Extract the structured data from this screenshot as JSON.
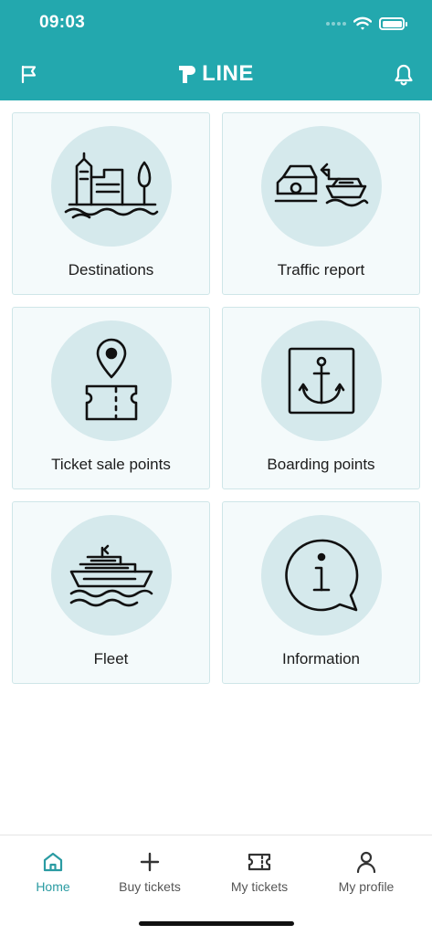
{
  "status_bar": {
    "time": "09:03"
  },
  "header": {
    "logo_mark": "P",
    "logo_text": "LINE",
    "left_icon": "flag-icon",
    "right_icon": "bell-icon"
  },
  "tiles": [
    {
      "label": "Destinations",
      "icon": "destinations-icon"
    },
    {
      "label": "Traffic report",
      "icon": "traffic-report-icon"
    },
    {
      "label": "Ticket sale points",
      "icon": "ticket-sale-points-icon"
    },
    {
      "label": "Boarding points",
      "icon": "anchor-icon"
    },
    {
      "label": "Fleet",
      "icon": "ship-icon"
    },
    {
      "label": "Information",
      "icon": "info-icon"
    }
  ],
  "tabbar": {
    "active": "Home",
    "items": [
      {
        "label": "Home",
        "icon": "home-icon"
      },
      {
        "label": "Buy tickets",
        "icon": "plus-icon"
      },
      {
        "label": "My tickets",
        "icon": "ticket-icon"
      },
      {
        "label": "My profile",
        "icon": "person-icon"
      }
    ]
  },
  "colors": {
    "brand": "#23a8ae",
    "tile_bg": "#f4fafb",
    "circle_bg": "#d5e9ec",
    "active_tab": "#2a9ba2"
  }
}
